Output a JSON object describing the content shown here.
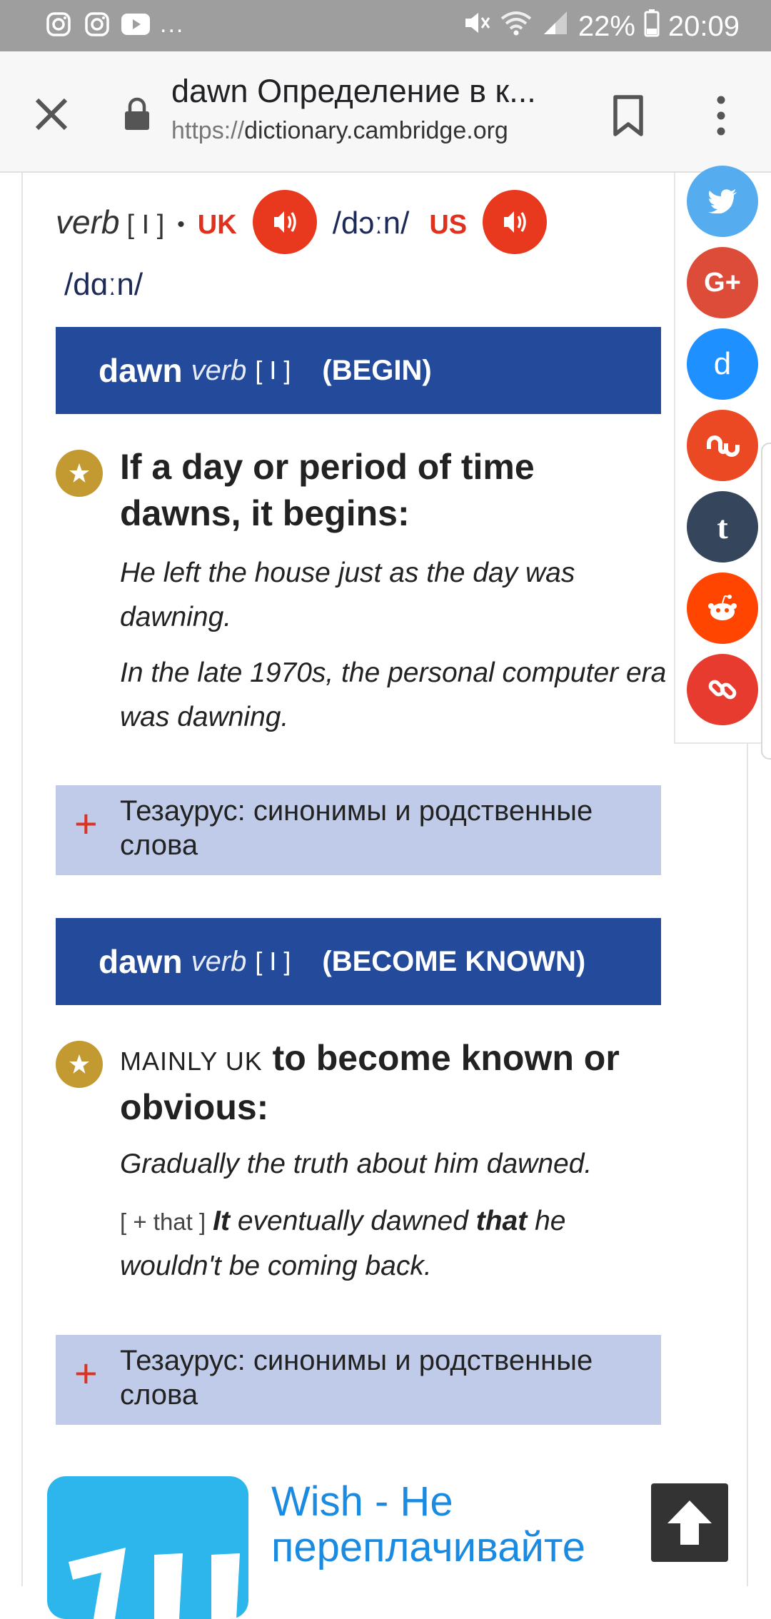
{
  "status_bar": {
    "left_icons": [
      "instagram-icon",
      "instagram-icon",
      "youtube-icon"
    ],
    "overflow": "...",
    "battery": "22%",
    "time": "20:09"
  },
  "toolbar": {
    "title": "dawn Определение в к...",
    "url_proto": "https://",
    "url_host": "dictionary.cambridge.org"
  },
  "pronunciation": {
    "pos": "verb",
    "grammar": "[ I ]",
    "bullet": "•",
    "uk_label": "UK",
    "uk_ipa": "/dɔːn/",
    "us_label": "US",
    "us_ipa": "/dɑːn/"
  },
  "senses": [
    {
      "word": "dawn",
      "pos": "verb",
      "grammar": "[ I ]",
      "guideword": "(BEGIN)",
      "label": "",
      "definition": "If a day or period of time dawns, it begins:",
      "examples": [
        "He left the house just as the day was dawning.",
        "In the late 1970s, the personal computer era was dawning."
      ],
      "thesaurus": "Тезаурус: синонимы и родственные слова"
    },
    {
      "word": "dawn",
      "pos": "verb",
      "grammar": "[ I ]",
      "guideword": "(BECOME KNOWN)",
      "label": "MAINLY UK",
      "definition": "to become known or obvious:",
      "examples": [
        "Gradually the truth about him dawned.",
        "It eventually dawned that he wouldn't be coming back."
      ],
      "example2_pattern": "[ + that ]",
      "example2_parts": [
        "It",
        " eventually dawned ",
        "that",
        " he wouldn't be coming back."
      ],
      "thesaurus": "Тезаурус: синонимы и родственные слова"
    }
  ],
  "share": [
    {
      "name": "twitter",
      "color": "#55acee"
    },
    {
      "name": "google-plus",
      "color": "#dd4b39"
    },
    {
      "name": "delicious",
      "color": "#1e90ff"
    },
    {
      "name": "stumbleupon",
      "color": "#eb4924"
    },
    {
      "name": "tumblr",
      "color": "#35465c"
    },
    {
      "name": "reddit",
      "color": "#ff4500"
    },
    {
      "name": "link",
      "color": "#e63b2e"
    }
  ],
  "ad": {
    "text": "Wish - Не переплачивайте"
  }
}
